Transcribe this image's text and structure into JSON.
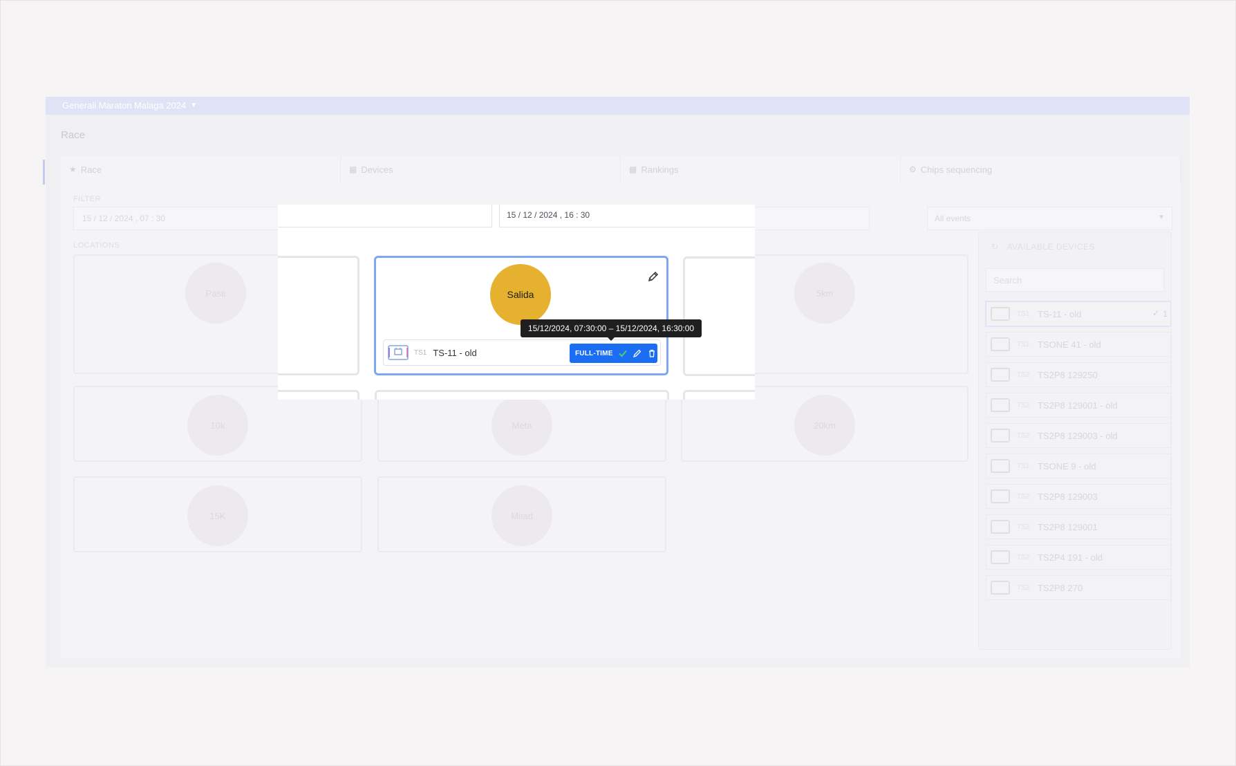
{
  "race_selector": {
    "label": "Generali Maraton Malaga 2024"
  },
  "page": {
    "title": "Race"
  },
  "tabs": [
    {
      "label": "Race",
      "icon": "trophy-icon"
    },
    {
      "label": "Devices",
      "icon": "grid-icon"
    },
    {
      "label": "Rankings",
      "icon": "podium-icon"
    },
    {
      "label": "Chips sequencing",
      "icon": "gear-icon"
    }
  ],
  "filter": {
    "label": "FILTER",
    "from": "15 / 12 / 2024 , 07 : 30",
    "to": "15 / 12 / 2024 , 16 : 30",
    "events": "All events"
  },
  "locations": {
    "label": "LOCATIONS",
    "background_items": [
      "Pasti",
      "5km",
      "10k",
      "Meta",
      "Salida",
      "5km",
      "20km",
      "15K",
      "Mitad"
    ]
  },
  "active_location": {
    "name": "Salida",
    "color": "#e6b12e",
    "device": {
      "type": "TS1",
      "name": "TS-11 - old",
      "mode": "FULL-TIME"
    }
  },
  "tooltip": {
    "text": "15/12/2024, 07:30:00 – 15/12/2024, 16:30:00"
  },
  "available_devices": {
    "title": "AVAILABLE DEVICES",
    "search_placeholder": "Search",
    "items": [
      {
        "type": "TS1",
        "name": "TS-11 - old",
        "count": "1",
        "selected": true
      },
      {
        "type": "TS1",
        "name": "TSONE 41 - old"
      },
      {
        "type": "TS2",
        "name": "TS2P8 129250"
      },
      {
        "type": "TS2",
        "name": "TS2P8 129001 - old"
      },
      {
        "type": "TS2",
        "name": "TS2P8 129003 - old"
      },
      {
        "type": "TS1",
        "name": "TSONE 9 - old"
      },
      {
        "type": "TS2",
        "name": "TS2P8 129003"
      },
      {
        "type": "TS2",
        "name": "TS2P8 129001"
      },
      {
        "type": "TS2",
        "name": "TS2P4 191 - old"
      },
      {
        "type": "TS2",
        "name": "TS2P8 270"
      }
    ]
  },
  "colors": {
    "accent": "#1b6ef3",
    "selected_border": "#7ea7f3",
    "salida": "#e6b12e"
  }
}
